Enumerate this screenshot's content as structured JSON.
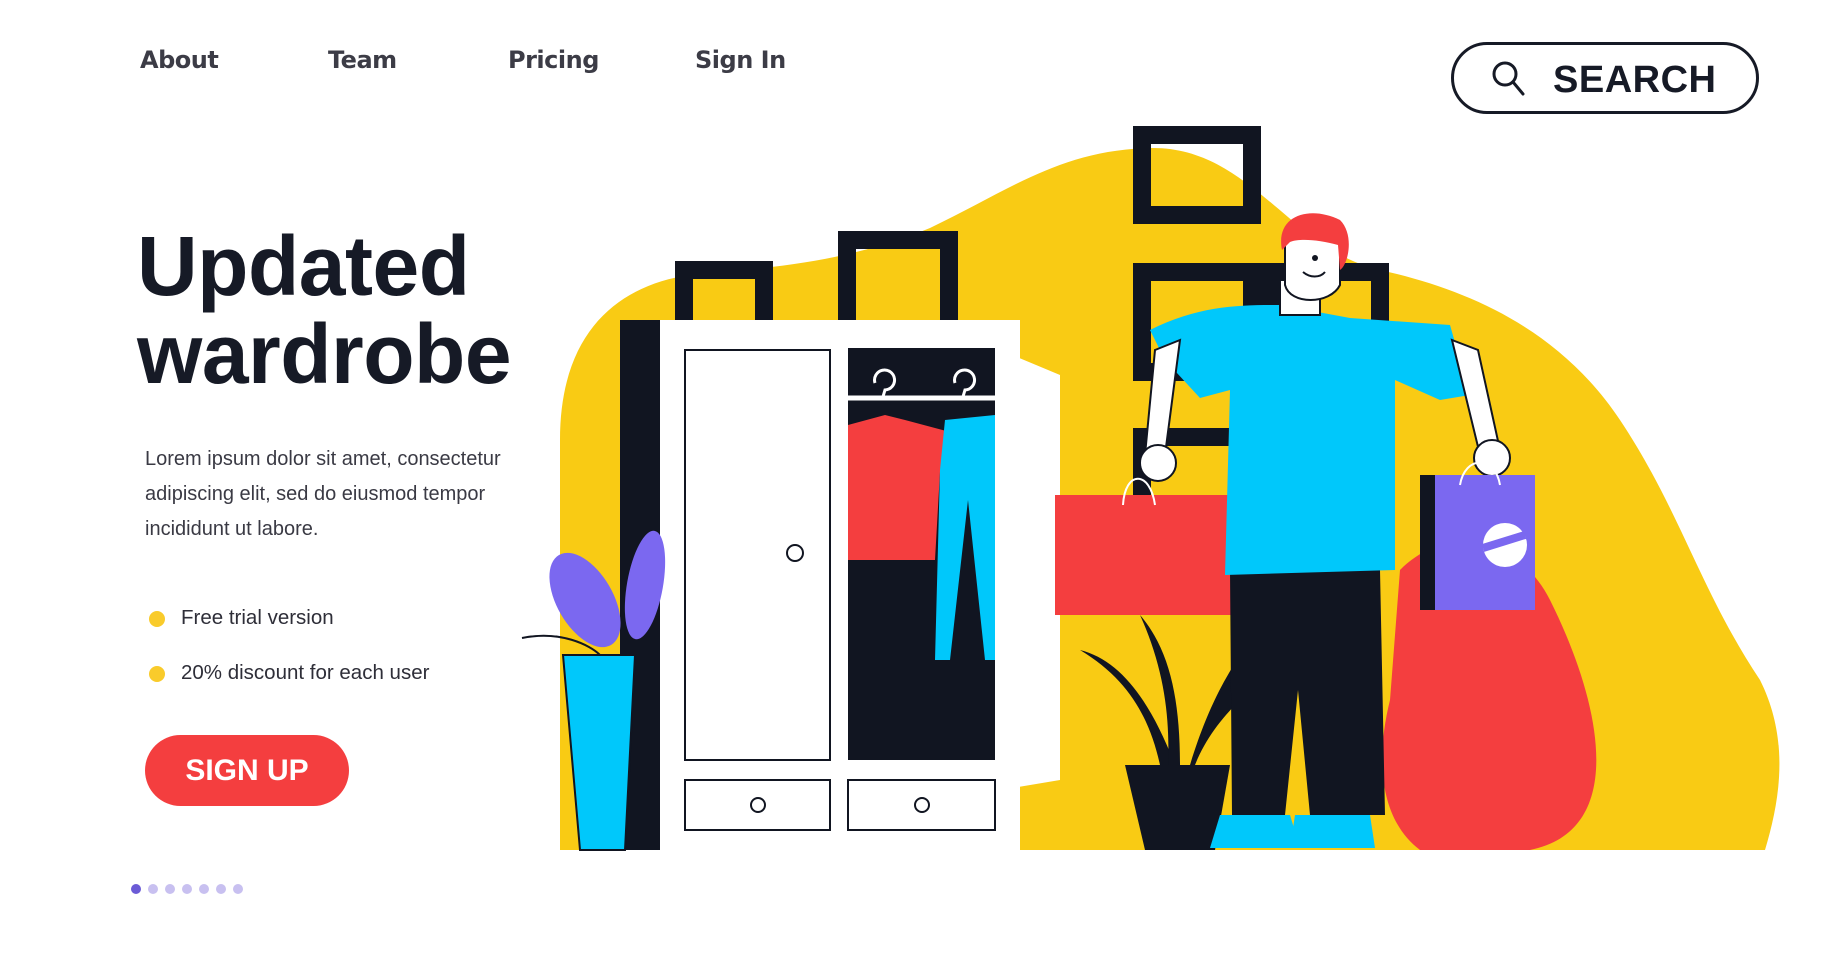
{
  "nav": {
    "items": [
      {
        "label": "About"
      },
      {
        "label": "Team"
      },
      {
        "label": "Pricing"
      },
      {
        "label": "Sign In"
      }
    ]
  },
  "search": {
    "label": "SEARCH",
    "icon": "search-icon"
  },
  "hero": {
    "title_line1": "Updated",
    "title_line2": "wardrobe",
    "description": "Lorem ipsum dolor sit amet, consectetur adipiscing elit, sed do eiusmod tempor incididunt ut labore.",
    "bullets": [
      {
        "text": "Free trial version"
      },
      {
        "text": "20% discount for each user"
      }
    ],
    "cta_label": "SIGN UP"
  },
  "pager": {
    "total": 7,
    "active": 1
  },
  "illustration": {
    "subject": "man holding shopping bags next to open wardrobe",
    "colors": {
      "yellow": "#f9cb14",
      "navy": "#111521",
      "red": "#f43e3f",
      "cyan": "#00c8fb",
      "purple": "#7b68f0",
      "white": "#ffffff"
    }
  },
  "colors": {
    "text_dark": "#161a26",
    "accent_red": "#f43e3f",
    "bullet_yellow": "#f9cb2b",
    "pager_active": "#6b5bd6",
    "pager_inactive": "#c8c0f0"
  }
}
